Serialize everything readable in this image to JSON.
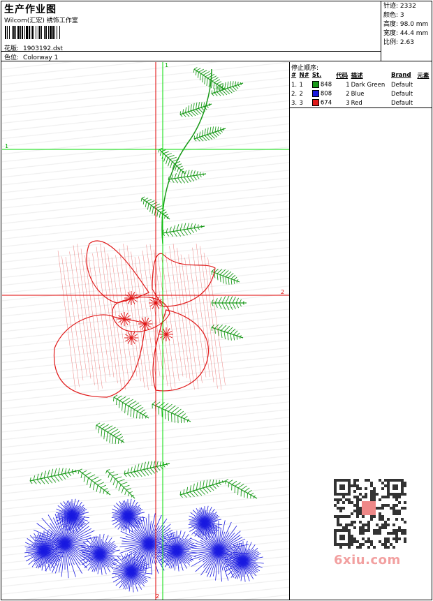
{
  "header": {
    "title": "生产作业图",
    "company": "Wilcom(汇宏) 绣饰工作室",
    "design_label": "花版:",
    "design_value": "1903192.dst",
    "colorway_label": "色位:",
    "colorway_value": "Colorway 1"
  },
  "stats": {
    "stitches": "针迹: 2332",
    "colors": "颜色: 3",
    "height": "高度: 98.0 mm",
    "width": "宽度: 44.4 mm",
    "ratio": "比例: 2.63"
  },
  "stop_sequence": {
    "title": "停止顺序:",
    "columns": [
      "#",
      "N#",
      "St.",
      "代码",
      "描述",
      "Brand",
      "元素"
    ],
    "rows": [
      {
        "idx": "1.",
        "n": "1",
        "color": "#1a9a1a",
        "st": "848",
        "code": "1",
        "desc": "Dark Green",
        "brand": "Default"
      },
      {
        "idx": "2.",
        "n": "2",
        "color": "#1a1ae0",
        "st": "808",
        "code": "2",
        "desc": "Blue",
        "brand": "Default"
      },
      {
        "idx": "3.",
        "n": "3",
        "color": "#e01a1a",
        "st": "674",
        "code": "3",
        "desc": "Red",
        "brand": "Default"
      }
    ]
  },
  "guides": {
    "v1_label": "1",
    "h1_label": "1",
    "h2_label": "2",
    "v2_label": "2"
  },
  "watermark": {
    "text": "6xiu.com",
    "qr_badge": "以阿图图"
  },
  "colors": {
    "guide": "#00dd00",
    "guide_red": "#e00000",
    "green": "#1a9a1a",
    "blue": "#1a1ae0",
    "red": "#e01a1a"
  }
}
